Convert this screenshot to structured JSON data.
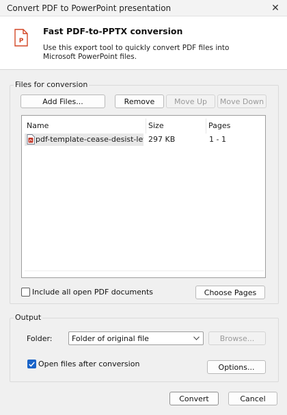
{
  "window": {
    "title": "Convert PDF to PowerPoint presentation",
    "close_glyph": "✕"
  },
  "header": {
    "title": "Fast PDF-to-PPTX conversion",
    "description": "Use this export tool to quickly convert PDF files into Microsoft PowerPoint files.",
    "icon": "powerpoint-file-icon",
    "accent_color": "#d24726"
  },
  "files_group": {
    "label": "Files for conversion",
    "buttons": {
      "add": "Add Files...",
      "remove": "Remove",
      "move_up": "Move Up",
      "move_down": "Move Down"
    },
    "columns": {
      "name": "Name",
      "size": "Size",
      "pages": "Pages"
    },
    "rows": [
      {
        "name": "pdf-template-cease-desist-let...",
        "size": "297 KB",
        "pages": "1 - 1",
        "icon": "pdf-file-icon"
      }
    ],
    "include_all": {
      "label": "Include all open PDF documents",
      "checked": false
    },
    "choose_pages": "Choose Pages"
  },
  "output_group": {
    "label": "Output",
    "folder_label": "Folder:",
    "folder_value": "Folder of original file",
    "browse": "Browse...",
    "open_after": {
      "label": "Open files after conversion",
      "checked": true
    },
    "options": "Options..."
  },
  "footer": {
    "convert": "Convert",
    "cancel": "Cancel"
  },
  "colors": {
    "checkbox_checked": "#1a64c8",
    "pdf_icon": "#c0392b"
  }
}
